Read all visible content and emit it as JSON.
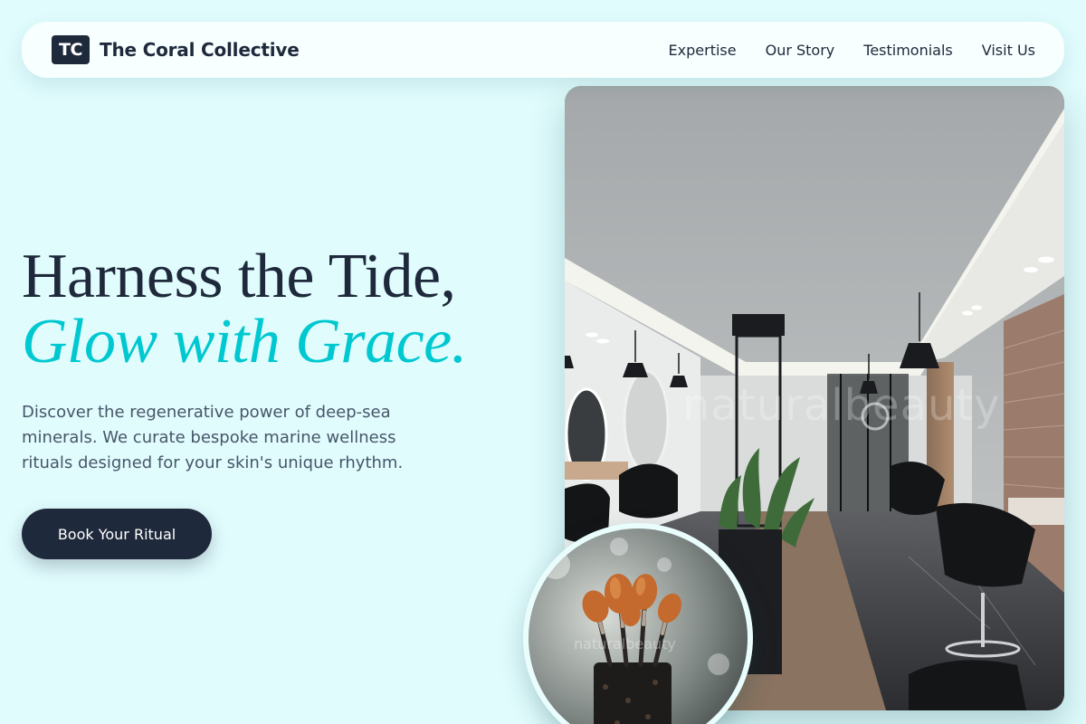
{
  "brand": {
    "logo_text": "TC",
    "name": "The Coral Collective"
  },
  "nav": {
    "links": [
      {
        "label": "Expertise"
      },
      {
        "label": "Our Story"
      },
      {
        "label": "Testimonials"
      },
      {
        "label": "Visit Us"
      }
    ]
  },
  "hero": {
    "headline_line1": "Harness the Tide,",
    "headline_line2": "Glow with Grace.",
    "body": "Discover the regenerative power of deep-sea minerals. We curate bespoke marine wellness rituals designed for your skin's unique rhythm.",
    "cta_label": "Book Your Ritual"
  },
  "images": {
    "salon_watermark": "naturalbeauty",
    "brushes_watermark": "naturalbeauty"
  },
  "colors": {
    "background": "#e0fcfd",
    "primary_dark": "#1e293b",
    "accent_teal": "#00c8d0",
    "body_text": "#475569",
    "nav_bg": "#f7ffff"
  }
}
